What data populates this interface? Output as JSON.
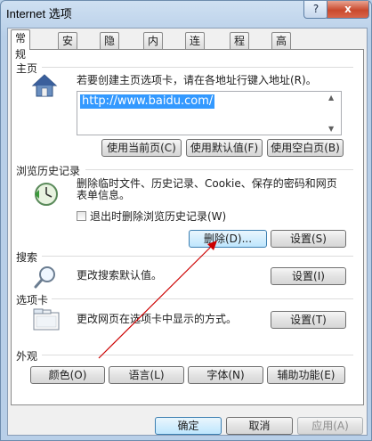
{
  "window": {
    "title": "Internet 选项",
    "help_label": "?",
    "close_label": "x"
  },
  "tabs": [
    "常规",
    "安全",
    "隐私",
    "内容",
    "连接",
    "程序",
    "高级"
  ],
  "home": {
    "title": "主页",
    "description": "若要创建主页选项卡，请在各地址行键入地址(R)。",
    "url": "http://www.baidu.com/",
    "buttons": [
      "使用当前页(C)",
      "使用默认值(F)",
      "使用空白页(B)"
    ]
  },
  "history": {
    "title": "浏览历史记录",
    "description_line1": "删除临时文件、历史记录、Cookie、保存的密码和网页",
    "description_line2": "表单信息。",
    "checkbox_label": "退出时删除浏览历史记录(W)",
    "delete_label": "删除(D)...",
    "settings_label": "设置(S)"
  },
  "search": {
    "title": "搜索",
    "description": "更改搜索默认值。",
    "settings_label": "设置(I)"
  },
  "tabbed": {
    "title": "选项卡",
    "description": "更改网页在选项卡中显示的方式。",
    "settings_label": "设置(T)"
  },
  "appearance": {
    "title": "外观",
    "buttons": [
      "颜色(O)",
      "语言(L)",
      "字体(N)",
      "辅助功能(E)"
    ]
  },
  "footer": {
    "ok_label": "确定",
    "cancel_label": "取消",
    "apply_label": "应用(A)"
  },
  "colors": {
    "accent": "#3399ff",
    "annotation_arrow": "#cc0000",
    "close_button": "#c9492d"
  }
}
